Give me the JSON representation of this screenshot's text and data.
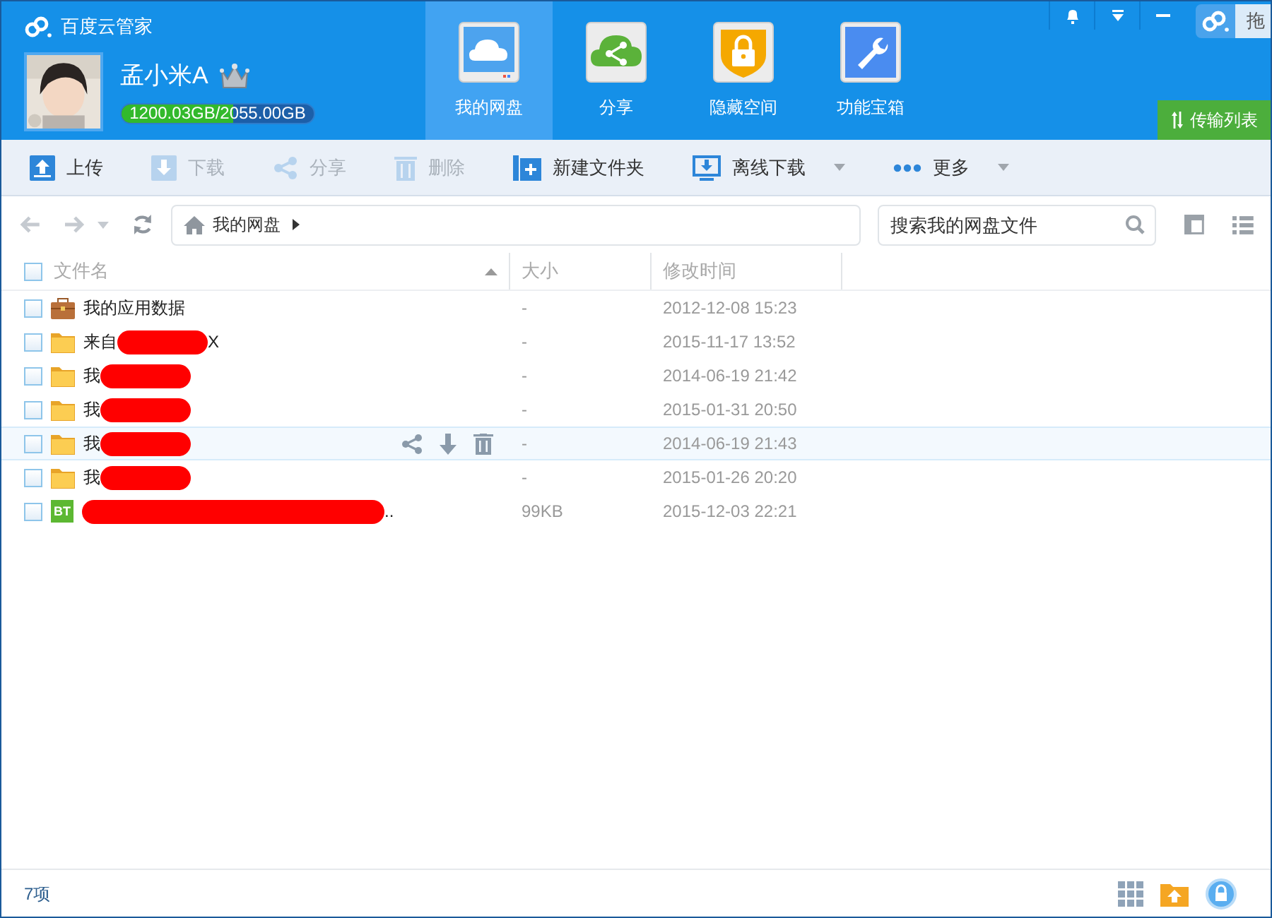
{
  "app": {
    "title": "百度云管家"
  },
  "user": {
    "name": "孟小米A",
    "storage": {
      "text": "1200.03GB/2055.00GB",
      "level": 0.584
    }
  },
  "nav_tabs": [
    {
      "label": "我的网盘",
      "selected": true
    },
    {
      "label": "分享",
      "selected": false
    },
    {
      "label": "隐藏空间",
      "selected": false
    },
    {
      "label": "功能宝箱",
      "selected": false
    }
  ],
  "window_controls": {
    "peek_label": "拖"
  },
  "transfer_button": {
    "label": "传输列表"
  },
  "toolbar": [
    {
      "label": "上传",
      "disabled": false,
      "dropdown": false
    },
    {
      "label": "下载",
      "disabled": true,
      "dropdown": false
    },
    {
      "label": "分享",
      "disabled": true,
      "dropdown": false
    },
    {
      "label": "删除",
      "disabled": true,
      "dropdown": false
    },
    {
      "label": "新建文件夹",
      "disabled": false,
      "dropdown": false
    },
    {
      "label": "离线下载",
      "disabled": false,
      "dropdown": true
    },
    {
      "label": "更多",
      "disabled": false,
      "dropdown": true
    }
  ],
  "breadcrumb": [
    "我的网盘"
  ],
  "search": {
    "placeholder": "搜索我的网盘文件"
  },
  "table": {
    "select_all": {
      "checked": false
    },
    "columns": [
      "文件名",
      "大小",
      "修改时间"
    ],
    "rows": [
      {
        "kind": "appdata",
        "name_start": "我的应用数据",
        "name_end": "",
        "redacted": false,
        "size": "-",
        "modified": "2012-12-08 15:23",
        "checked": false,
        "hovered": false
      },
      {
        "kind": "folder",
        "name_start": "来自",
        "name_end": "X",
        "redacted": true,
        "size": "-",
        "modified": "2015-11-17 13:52",
        "checked": false,
        "hovered": false
      },
      {
        "kind": "folder",
        "name_start": "我",
        "name_end": "",
        "redacted": true,
        "size": "-",
        "modified": "2014-06-19 21:42",
        "checked": false,
        "hovered": false
      },
      {
        "kind": "folder",
        "name_start": "我",
        "name_end": "",
        "redacted": true,
        "size": "-",
        "modified": "2015-01-31 20:50",
        "checked": false,
        "hovered": false
      },
      {
        "kind": "folder",
        "name_start": "我",
        "name_end": "",
        "redacted": true,
        "size": "-",
        "modified": "2014-06-19 21:43",
        "checked": false,
        "hovered": true
      },
      {
        "kind": "folder",
        "name_start": "我",
        "name_end": "",
        "redacted": true,
        "size": "-",
        "modified": "2015-01-26 20:20",
        "checked": false,
        "hovered": false
      },
      {
        "kind": "bt",
        "icon_text": "BT",
        "name_start": "",
        "name_end": "..",
        "redacted": true,
        "size": "99KB",
        "modified": "2015-12-03 22:21",
        "checked": false,
        "hovered": false
      }
    ]
  },
  "status_bar": {
    "count": "7项"
  }
}
